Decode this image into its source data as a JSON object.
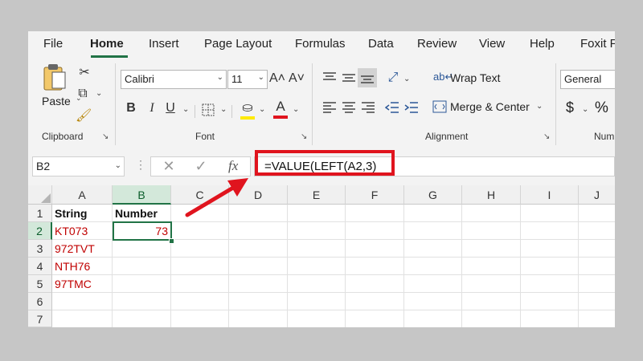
{
  "tabs": [
    "File",
    "Home",
    "Insert",
    "Page Layout",
    "Formulas",
    "Data",
    "Review",
    "View",
    "Help",
    "Foxit F"
  ],
  "ribbon": {
    "clipboard": {
      "paste_label": "Paste",
      "group_label": "Clipboard"
    },
    "font": {
      "font_name": "Calibri",
      "font_size": "11",
      "group_label": "Font",
      "bold": "B",
      "italic": "I",
      "underline": "U",
      "grow": "A˄",
      "shrink": "A˅",
      "font_color_letter": "A"
    },
    "alignment": {
      "wrap_text_label": "Wrap Text",
      "merge_center_label": "Merge & Center",
      "group_label": "Alignment"
    },
    "number": {
      "format": "General",
      "currency": "$",
      "percent": "%",
      "group_label": "Num"
    }
  },
  "formula_bar": {
    "name_box": "B2",
    "fx": "fx",
    "formula": "=VALUE(LEFT(A2,3)"
  },
  "sheet": {
    "columns": [
      "A",
      "B",
      "C",
      "D",
      "E",
      "F",
      "G",
      "H",
      "I",
      "J"
    ],
    "rows": [
      "1",
      "2",
      "3",
      "4",
      "5",
      "6",
      "7"
    ],
    "cells": {
      "A1": "String",
      "B1": "Number",
      "A2": "KT073",
      "B2": "73",
      "A3": "972TVT",
      "A4": "NTH76",
      "A5": "97TMC"
    }
  },
  "colors": {
    "accent": "#217346",
    "annotation_red": "#e0141e",
    "text_red": "#c00000"
  }
}
